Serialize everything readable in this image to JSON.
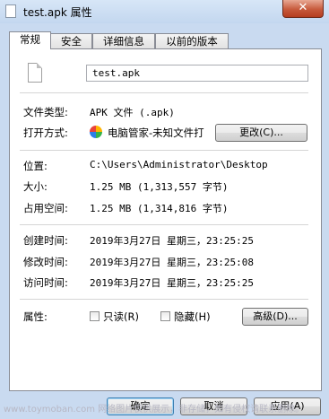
{
  "window": {
    "title": "test.apk 属性",
    "close_glyph": "✕"
  },
  "tabs": [
    "常规",
    "安全",
    "详细信息",
    "以前的版本"
  ],
  "file": {
    "name": "test.apk"
  },
  "props": {
    "type_label": "文件类型:",
    "type_value": "APK 文件 (.apk)",
    "open_label": "打开方式:",
    "open_value": "电脑管家-未知文件打",
    "change_button": "更改(C)...",
    "location_label": "位置:",
    "location_value": "C:\\Users\\Administrator\\Desktop",
    "size_label": "大小:",
    "size_value": "1.25 MB (1,313,557 字节)",
    "disk_label": "占用空间:",
    "disk_value": "1.25 MB (1,314,816 字节)",
    "created_label": "创建时间:",
    "created_value": "2019年3月27日 星期三，23:25:25",
    "modified_label": "修改时间:",
    "modified_value": "2019年3月27日 星期三，23:25:08",
    "accessed_label": "访问时间:",
    "accessed_value": "2019年3月27日 星期三，23:25:25",
    "attr_label": "属性:",
    "readonly_label": "只读(R)",
    "hidden_label": "隐藏(H)",
    "advanced_button": "高级(D)..."
  },
  "buttons": {
    "ok": "确定",
    "cancel": "取消",
    "apply": "应用(A)"
  },
  "watermark": "www.toymoban.com 网络图片仅供展示，非存储，如有侵权请联系删除。"
}
